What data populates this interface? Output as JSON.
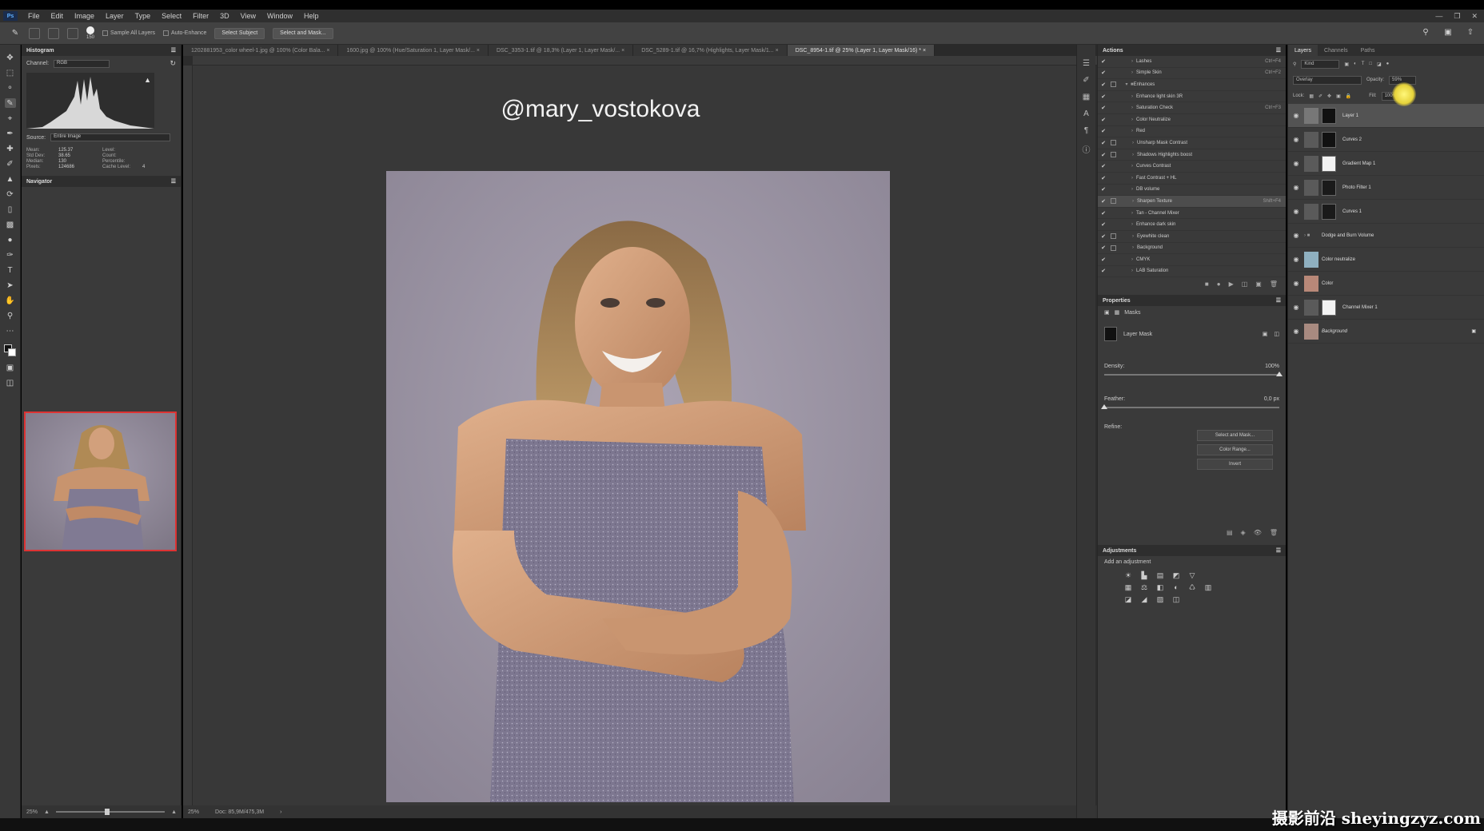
{
  "menubar": {
    "app_icon": "Ps",
    "items": [
      "File",
      "Edit",
      "Image",
      "Layer",
      "Type",
      "Select",
      "Filter",
      "3D",
      "View",
      "Window",
      "Help"
    ]
  },
  "options": {
    "brush_size": "150",
    "sample_all_layers": "Sample All Layers",
    "auto_enhance": "Auto-Enhance",
    "select_subject": "Select Subject",
    "select_and_mask": "Select and Mask..."
  },
  "histogram": {
    "title": "Histogram",
    "channel_label": "Channel:",
    "channel_value": "RGB",
    "source_label": "Source:",
    "source_value": "Entire Image",
    "stats": [
      {
        "label": "Mean:",
        "value": "125.37",
        "label2": "Level:",
        "value2": ""
      },
      {
        "label": "Std Dev:",
        "value": "38.65",
        "label2": "Count:",
        "value2": ""
      },
      {
        "label": "Median:",
        "value": "130",
        "label2": "Percentile:",
        "value2": ""
      },
      {
        "label": "Pixels:",
        "value": "124686",
        "label2": "Cache Level:",
        "value2": "4"
      }
    ]
  },
  "navigator": {
    "title": "Navigator",
    "zoom": "25%"
  },
  "tabs": [
    {
      "label": "1202881953_color wheel-1.jpg @ 100% (Color Bala...",
      "active": false
    },
    {
      "label": "1600.jpg @ 100% (Hue/Saturation 1, Layer Mask/...",
      "active": false
    },
    {
      "label": "DSC_3353-1.tif @ 18,3% (Layer 1, Layer Mask/...",
      "active": false
    },
    {
      "label": "DSC_5289-1.tif @ 16,7% (Highlights, Layer Mask/1...",
      "active": false
    },
    {
      "label": "DSC_8954-1.tif @ 25% (Layer 1, Layer Mask/16) *",
      "active": true
    }
  ],
  "canvas": {
    "watermark": "@mary_vostokova",
    "zoom": "25%",
    "doc_info": "Doc: 85,9M/475,3M"
  },
  "actions": {
    "title": "Actions",
    "items": [
      {
        "name": "Lashes",
        "shortcut": "Ctrl+F4",
        "indent": 1,
        "dialog": false,
        "selected": false
      },
      {
        "name": "Simple Skin",
        "shortcut": "Ctrl+F2",
        "indent": 1,
        "dialog": false,
        "selected": false
      },
      {
        "name": "Enhances",
        "shortcut": "",
        "indent": 0,
        "dialog": true,
        "selected": false
      },
      {
        "name": "Enhance light skin 3R",
        "shortcut": "",
        "indent": 1,
        "dialog": false,
        "selected": false
      },
      {
        "name": "Saturation Check",
        "shortcut": "Ctrl+F3",
        "indent": 1,
        "dialog": false,
        "selected": false
      },
      {
        "name": "Color Neutralize",
        "shortcut": "",
        "indent": 1,
        "dialog": false,
        "selected": false
      },
      {
        "name": "Red",
        "shortcut": "",
        "indent": 1,
        "dialog": false,
        "selected": false
      },
      {
        "name": "Unsharp Mask Contrast",
        "shortcut": "",
        "indent": 1,
        "dialog": true,
        "selected": false
      },
      {
        "name": "Shadows Highlights boost",
        "shortcut": "",
        "indent": 1,
        "dialog": true,
        "selected": false
      },
      {
        "name": "Curves Contrast",
        "shortcut": "",
        "indent": 1,
        "dialog": false,
        "selected": false
      },
      {
        "name": "Fast Contrast + HL",
        "shortcut": "",
        "indent": 1,
        "dialog": false,
        "selected": false
      },
      {
        "name": "DB volume",
        "shortcut": "",
        "indent": 1,
        "dialog": false,
        "selected": false
      },
      {
        "name": "Sharpen Texture",
        "shortcut": "Shift+F4",
        "indent": 1,
        "dialog": true,
        "selected": true
      },
      {
        "name": "Tan - Channel Mixer",
        "shortcut": "",
        "indent": 1,
        "dialog": false,
        "selected": false
      },
      {
        "name": "Enhance dark skin",
        "shortcut": "",
        "indent": 1,
        "dialog": false,
        "selected": false
      },
      {
        "name": "Eyewhite clean",
        "shortcut": "",
        "indent": 1,
        "dialog": true,
        "selected": false
      },
      {
        "name": "Background",
        "shortcut": "",
        "indent": 1,
        "dialog": true,
        "selected": false
      },
      {
        "name": "CMYK",
        "shortcut": "",
        "indent": 1,
        "dialog": false,
        "selected": false
      },
      {
        "name": "LAB Saturation",
        "shortcut": "",
        "indent": 1,
        "dialog": false,
        "selected": false
      }
    ]
  },
  "properties": {
    "title": "Properties",
    "masks_label": "Masks",
    "layer_mask_label": "Layer Mask",
    "density_label": "Density:",
    "density_value": "100%",
    "density_fraction": 1.0,
    "feather_label": "Feather:",
    "feather_value": "0,0 px",
    "feather_fraction": 0.0,
    "refine_label": "Refine:",
    "buttons": [
      "Select and Mask...",
      "Color Range...",
      "Invert"
    ]
  },
  "adjustments": {
    "title": "Adjustments",
    "hint": "Add an adjustment",
    "icons": [
      "☀",
      "▙",
      "▤",
      "◩",
      "▽",
      "▦",
      "⚖",
      "◧",
      "◐",
      "♺",
      "▥",
      "◪",
      "◢",
      "▨",
      "◫"
    ]
  },
  "layers": {
    "tabs": [
      "Layers",
      "Channels",
      "Paths"
    ],
    "kind_label": "Kind",
    "blend_mode": "Overlay",
    "opacity_label": "Opacity:",
    "opacity_value": "59%",
    "lock_label": "Lock:",
    "fill_label": "Fill:",
    "fill_value": "100%",
    "items": [
      {
        "name": "Layer 1",
        "thumb": "#777777",
        "mask": "#111111",
        "selected": true,
        "italic": false
      },
      {
        "name": "Curves 2",
        "thumb": "#5a5a5a",
        "mask": "#111111",
        "selected": false,
        "italic": false
      },
      {
        "name": "Gradient Map 1",
        "thumb": "#5a5a5a",
        "mask": "#f2f2f2",
        "selected": false,
        "italic": false
      },
      {
        "name": "Photo Filter 1",
        "thumb": "#5a5a5a",
        "mask": "#1a1a1a",
        "selected": false,
        "italic": false
      },
      {
        "name": "Curves 1",
        "thumb": "#5a5a5a",
        "mask": "#1a1a1a",
        "selected": false,
        "italic": false
      },
      {
        "name": "Dodge and Burn Volume",
        "thumb": "",
        "mask": "",
        "selected": false,
        "italic": false
      },
      {
        "name": "Color neutralize",
        "thumb": "#8fb0c0",
        "mask": "",
        "selected": false,
        "italic": false
      },
      {
        "name": "Color",
        "thumb": "#b88878",
        "mask": "",
        "selected": false,
        "italic": false
      },
      {
        "name": "Channel Mixer 1",
        "thumb": "#5a5a5a",
        "mask": "#f2f2f2",
        "selected": false,
        "italic": false
      },
      {
        "name": "Background",
        "thumb": "#a88a80",
        "mask": "",
        "selected": false,
        "italic": true
      }
    ]
  },
  "site_watermark": "摄影前沿 sheyingzyz.com"
}
